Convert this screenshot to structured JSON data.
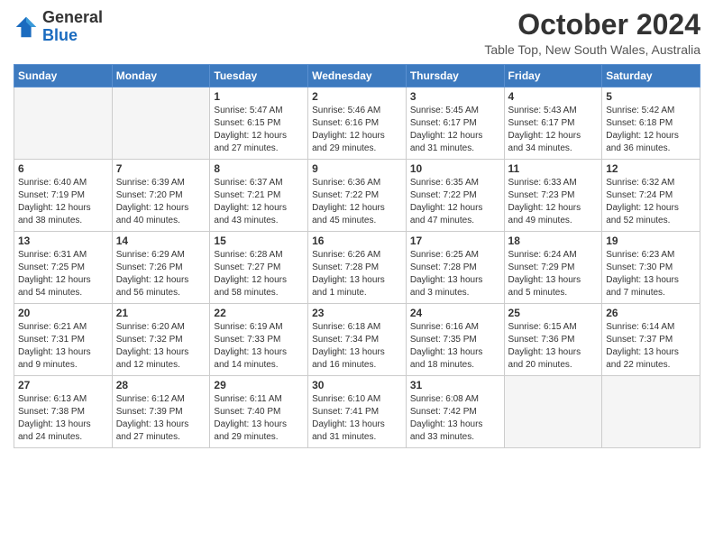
{
  "header": {
    "logo_general": "General",
    "logo_blue": "Blue",
    "title": "October 2024",
    "location": "Table Top, New South Wales, Australia"
  },
  "days_of_week": [
    "Sunday",
    "Monday",
    "Tuesday",
    "Wednesday",
    "Thursday",
    "Friday",
    "Saturday"
  ],
  "weeks": [
    [
      {
        "day": "",
        "empty": true
      },
      {
        "day": "",
        "empty": true
      },
      {
        "day": "1",
        "sunrise": "Sunrise: 5:47 AM",
        "sunset": "Sunset: 6:15 PM",
        "daylight": "Daylight: 12 hours and 27 minutes."
      },
      {
        "day": "2",
        "sunrise": "Sunrise: 5:46 AM",
        "sunset": "Sunset: 6:16 PM",
        "daylight": "Daylight: 12 hours and 29 minutes."
      },
      {
        "day": "3",
        "sunrise": "Sunrise: 5:45 AM",
        "sunset": "Sunset: 6:17 PM",
        "daylight": "Daylight: 12 hours and 31 minutes."
      },
      {
        "day": "4",
        "sunrise": "Sunrise: 5:43 AM",
        "sunset": "Sunset: 6:17 PM",
        "daylight": "Daylight: 12 hours and 34 minutes."
      },
      {
        "day": "5",
        "sunrise": "Sunrise: 5:42 AM",
        "sunset": "Sunset: 6:18 PM",
        "daylight": "Daylight: 12 hours and 36 minutes."
      }
    ],
    [
      {
        "day": "6",
        "sunrise": "Sunrise: 6:40 AM",
        "sunset": "Sunset: 7:19 PM",
        "daylight": "Daylight: 12 hours and 38 minutes."
      },
      {
        "day": "7",
        "sunrise": "Sunrise: 6:39 AM",
        "sunset": "Sunset: 7:20 PM",
        "daylight": "Daylight: 12 hours and 40 minutes."
      },
      {
        "day": "8",
        "sunrise": "Sunrise: 6:37 AM",
        "sunset": "Sunset: 7:21 PM",
        "daylight": "Daylight: 12 hours and 43 minutes."
      },
      {
        "day": "9",
        "sunrise": "Sunrise: 6:36 AM",
        "sunset": "Sunset: 7:22 PM",
        "daylight": "Daylight: 12 hours and 45 minutes."
      },
      {
        "day": "10",
        "sunrise": "Sunrise: 6:35 AM",
        "sunset": "Sunset: 7:22 PM",
        "daylight": "Daylight: 12 hours and 47 minutes."
      },
      {
        "day": "11",
        "sunrise": "Sunrise: 6:33 AM",
        "sunset": "Sunset: 7:23 PM",
        "daylight": "Daylight: 12 hours and 49 minutes."
      },
      {
        "day": "12",
        "sunrise": "Sunrise: 6:32 AM",
        "sunset": "Sunset: 7:24 PM",
        "daylight": "Daylight: 12 hours and 52 minutes."
      }
    ],
    [
      {
        "day": "13",
        "sunrise": "Sunrise: 6:31 AM",
        "sunset": "Sunset: 7:25 PM",
        "daylight": "Daylight: 12 hours and 54 minutes."
      },
      {
        "day": "14",
        "sunrise": "Sunrise: 6:29 AM",
        "sunset": "Sunset: 7:26 PM",
        "daylight": "Daylight: 12 hours and 56 minutes."
      },
      {
        "day": "15",
        "sunrise": "Sunrise: 6:28 AM",
        "sunset": "Sunset: 7:27 PM",
        "daylight": "Daylight: 12 hours and 58 minutes."
      },
      {
        "day": "16",
        "sunrise": "Sunrise: 6:26 AM",
        "sunset": "Sunset: 7:28 PM",
        "daylight": "Daylight: 13 hours and 1 minute."
      },
      {
        "day": "17",
        "sunrise": "Sunrise: 6:25 AM",
        "sunset": "Sunset: 7:28 PM",
        "daylight": "Daylight: 13 hours and 3 minutes."
      },
      {
        "day": "18",
        "sunrise": "Sunrise: 6:24 AM",
        "sunset": "Sunset: 7:29 PM",
        "daylight": "Daylight: 13 hours and 5 minutes."
      },
      {
        "day": "19",
        "sunrise": "Sunrise: 6:23 AM",
        "sunset": "Sunset: 7:30 PM",
        "daylight": "Daylight: 13 hours and 7 minutes."
      }
    ],
    [
      {
        "day": "20",
        "sunrise": "Sunrise: 6:21 AM",
        "sunset": "Sunset: 7:31 PM",
        "daylight": "Daylight: 13 hours and 9 minutes."
      },
      {
        "day": "21",
        "sunrise": "Sunrise: 6:20 AM",
        "sunset": "Sunset: 7:32 PM",
        "daylight": "Daylight: 13 hours and 12 minutes."
      },
      {
        "day": "22",
        "sunrise": "Sunrise: 6:19 AM",
        "sunset": "Sunset: 7:33 PM",
        "daylight": "Daylight: 13 hours and 14 minutes."
      },
      {
        "day": "23",
        "sunrise": "Sunrise: 6:18 AM",
        "sunset": "Sunset: 7:34 PM",
        "daylight": "Daylight: 13 hours and 16 minutes."
      },
      {
        "day": "24",
        "sunrise": "Sunrise: 6:16 AM",
        "sunset": "Sunset: 7:35 PM",
        "daylight": "Daylight: 13 hours and 18 minutes."
      },
      {
        "day": "25",
        "sunrise": "Sunrise: 6:15 AM",
        "sunset": "Sunset: 7:36 PM",
        "daylight": "Daylight: 13 hours and 20 minutes."
      },
      {
        "day": "26",
        "sunrise": "Sunrise: 6:14 AM",
        "sunset": "Sunset: 7:37 PM",
        "daylight": "Daylight: 13 hours and 22 minutes."
      }
    ],
    [
      {
        "day": "27",
        "sunrise": "Sunrise: 6:13 AM",
        "sunset": "Sunset: 7:38 PM",
        "daylight": "Daylight: 13 hours and 24 minutes."
      },
      {
        "day": "28",
        "sunrise": "Sunrise: 6:12 AM",
        "sunset": "Sunset: 7:39 PM",
        "daylight": "Daylight: 13 hours and 27 minutes."
      },
      {
        "day": "29",
        "sunrise": "Sunrise: 6:11 AM",
        "sunset": "Sunset: 7:40 PM",
        "daylight": "Daylight: 13 hours and 29 minutes."
      },
      {
        "day": "30",
        "sunrise": "Sunrise: 6:10 AM",
        "sunset": "Sunset: 7:41 PM",
        "daylight": "Daylight: 13 hours and 31 minutes."
      },
      {
        "day": "31",
        "sunrise": "Sunrise: 6:08 AM",
        "sunset": "Sunset: 7:42 PM",
        "daylight": "Daylight: 13 hours and 33 minutes."
      },
      {
        "day": "",
        "empty": true
      },
      {
        "day": "",
        "empty": true
      }
    ]
  ]
}
